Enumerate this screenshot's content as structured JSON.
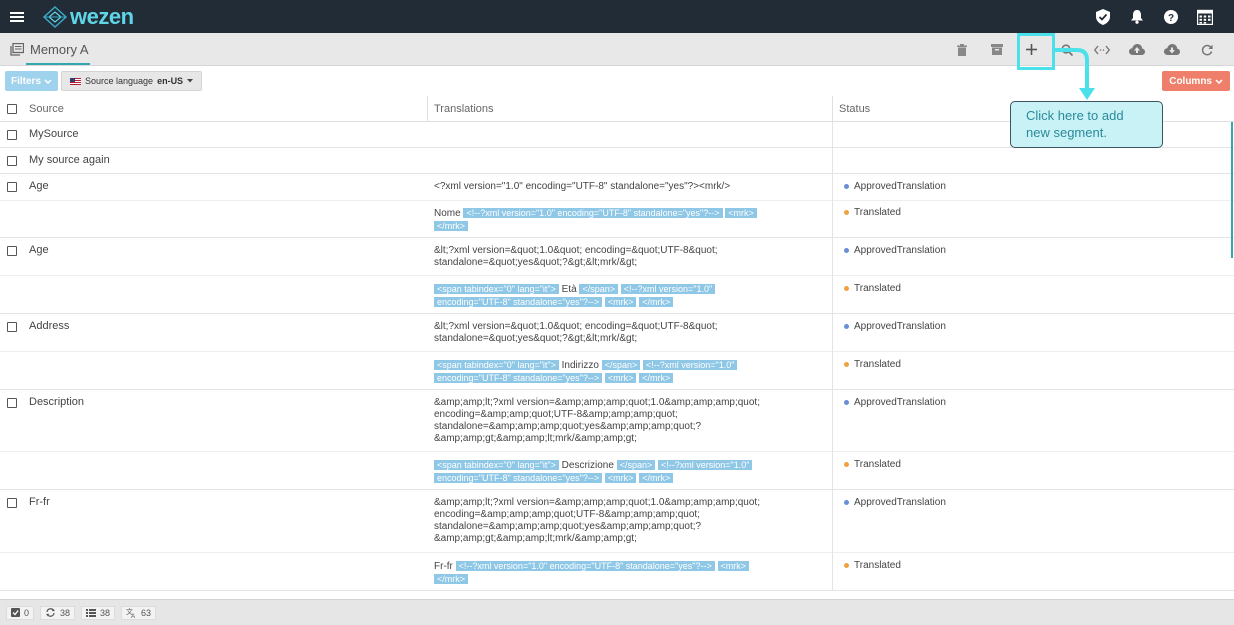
{
  "app": {
    "logo_text": "wezen"
  },
  "appbar_icons": [
    "shield-check-icon",
    "bell-icon",
    "help-icon",
    "calendar-grid-icon"
  ],
  "tab": {
    "label": "Memory A"
  },
  "toolbar_icons": [
    "trash-icon",
    "archive-icon",
    "plus-icon",
    "search-icon",
    "code-icon",
    "cloud-upload-icon",
    "cloud-download-icon",
    "refresh-icon"
  ],
  "filters": {
    "filters_label": "Filters",
    "source_language_label": "Source language",
    "source_language_value": "en-US",
    "columns_label": "Columns"
  },
  "columns": {
    "source": "Source",
    "translations": "Translations",
    "status": "Status"
  },
  "callout": {
    "text": "Click here to add new segment."
  },
  "rows": [
    {
      "source": "MySource"
    },
    {
      "source": "My source again"
    },
    {
      "source": "Age",
      "t1": "<?xml version=\"1.0\" encoding=\"UTF-8\" standalone=\"yes\"?><mrk/>",
      "s1": "ApprovedTranslation",
      "t2_text": "Nome",
      "t2_tag1": "<!--?xml version=\"1.0\" encoding=\"UTF-8\" standalone=\"yes\"?-->",
      "t2_tag2": "<mrk>",
      "t2_tag3": "</mrk>",
      "s2": "Translated"
    },
    {
      "source": "Age",
      "t1a": "&lt;?xml version=&quot;1.0&quot; encoding=&quot;UTF-8&quot;",
      "t1b": "standalone=&quot;yes&quot;?&gt;&lt;mrk/&gt;",
      "s1": "ApprovedTranslation",
      "t2_tag1": "<span tabindex=\"0\" lang=\"it\">",
      "t2_text": "Età",
      "t2_tag2": "</span>",
      "t2_tag3a": "<!--?xml version=\"1.0\"",
      "t2_tag3b": "encoding=\"UTF-8\" standalone=\"yes\"?-->",
      "t2_tag4": "<mrk>",
      "t2_tag5": "</mrk>",
      "s2": "Translated"
    },
    {
      "source": "Address",
      "t1a": "&lt;?xml version=&quot;1.0&quot; encoding=&quot;UTF-8&quot;",
      "t1b": "standalone=&quot;yes&quot;?&gt;&lt;mrk/&gt;",
      "s1": "ApprovedTranslation",
      "t2_tag1": "<span tabindex=\"0\" lang=\"it\">",
      "t2_text": "Indirizzo",
      "t2_tag2": "</span>",
      "t2_tag3a": "<!--?xml version=\"1.0\"",
      "t2_tag3b": "encoding=\"UTF-8\" standalone=\"yes\"?-->",
      "t2_tag4": "<mrk>",
      "t2_tag5": "</mrk>",
      "s2": "Translated"
    },
    {
      "source": "Description",
      "t1a": "&amp;amp;lt;?xml version=&amp;amp;amp;quot;1.0&amp;amp;amp;quot;",
      "t1b": "encoding=&amp;amp;quot;UTF-8&amp;amp;amp;quot;",
      "t1c": "standalone=&amp;amp;amp;quot;yes&amp;amp;amp;quot;?",
      "t1d": "&amp;amp;gt;&amp;amp;lt;mrk/&amp;amp;gt;",
      "s1": "ApprovedTranslation",
      "t2_tag1": "<span tabindex=\"0\" lang=\"it\">",
      "t2_text": "Descrizione",
      "t2_tag2": "</span>",
      "t2_tag3a": "<!--?xml version=\"1.0\"",
      "t2_tag3b": "encoding=\"UTF-8\" standalone=\"yes\"?-->",
      "t2_tag4": "<mrk>",
      "t2_tag5": "</mrk>",
      "s2": "Translated"
    },
    {
      "source": "Fr-fr",
      "t1a": "&amp;amp;lt;?xml version=&amp;amp;amp;quot;1.0&amp;amp;amp;quot;",
      "t1b": "encoding=&amp;amp;amp;quot;UTF-8&amp;amp;amp;quot;",
      "t1c": "standalone=&amp;amp;amp;quot;yes&amp;amp;amp;quot;?",
      "t1d": "&amp;amp;gt;&amp;amp;lt;mrk/&amp;amp;gt;",
      "s1": "ApprovedTranslation",
      "t2_text": "Fr-fr",
      "t2_tag1": "<!--?xml version=\"1.0\" encoding=\"UTF-8\" standalone=\"yes\"?-->",
      "t2_tag2": "<mrk>",
      "t2_tag3": "</mrk>",
      "s2": "Translated"
    }
  ],
  "footer": {
    "selected": "0",
    "sync": "38",
    "list": "38",
    "translate": "63"
  }
}
